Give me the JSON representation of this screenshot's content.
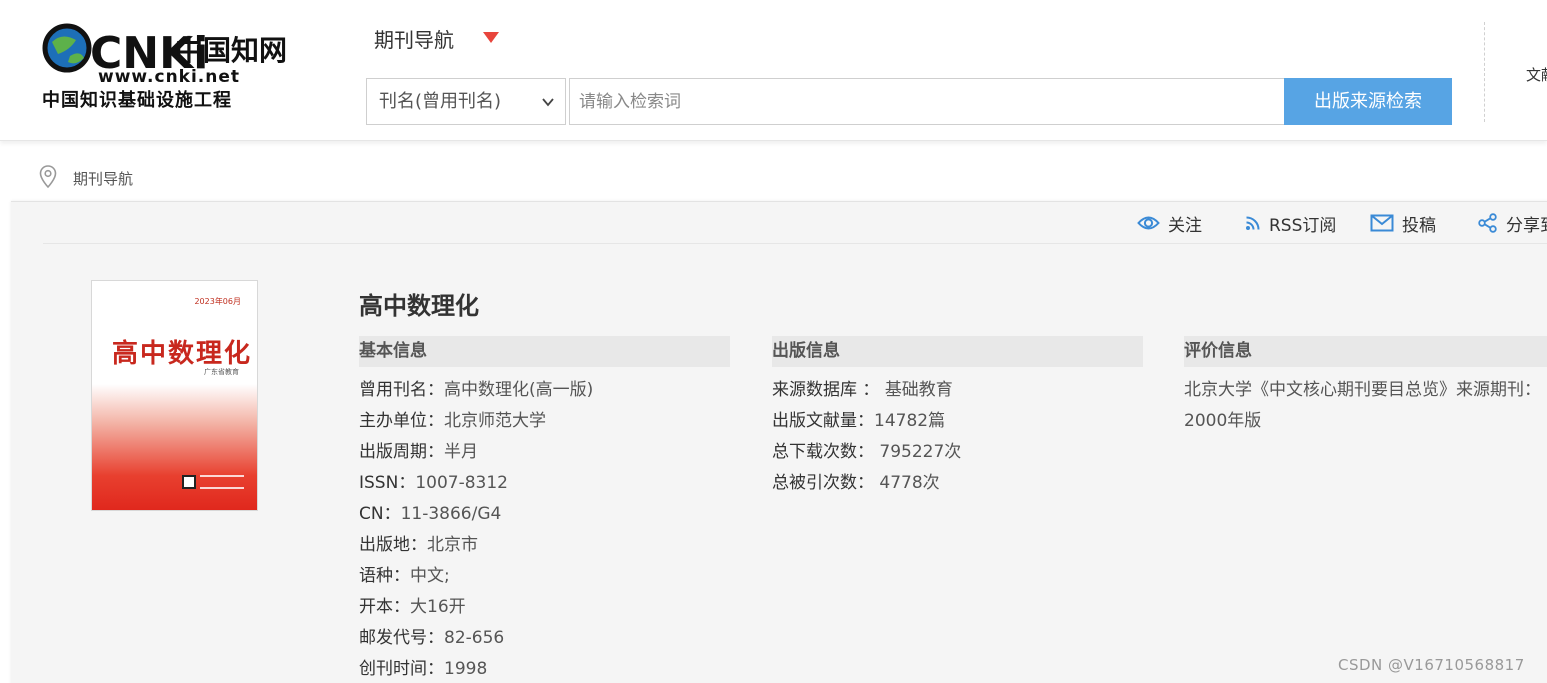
{
  "header": {
    "logo": {
      "brand_latin": "CNKi",
      "brand_cn": "中国知网",
      "url": "www.cnki.net",
      "tagline": "中国知识基础设施工程"
    },
    "nav_title": "期刊导航",
    "search": {
      "field_selected": "刊名(曾用刊名)",
      "placeholder": "请输入检索词",
      "button_label": "出版来源检索"
    },
    "extra_text": "文献"
  },
  "breadcrumb": {
    "label": "期刊导航"
  },
  "toolbar": {
    "follow": "关注",
    "rss": "RSS订阅",
    "submit": "投稿",
    "share": "分享到"
  },
  "journal": {
    "title": "高中数理化",
    "cover": {
      "title": "高中数理化",
      "date": "2023年06月",
      "publisher": "广东省教育"
    },
    "basic_info": {
      "heading": "基本信息",
      "rows": [
        {
          "key": "曾用刊名：",
          "value": "高中数理化(高一版)"
        },
        {
          "key": "主办单位：",
          "value": "北京师范大学"
        },
        {
          "key": "出版周期：",
          "value": "半月"
        },
        {
          "key": "ISSN：",
          "value": "1007-8312"
        },
        {
          "key": "CN：",
          "value": "11-3866/G4"
        },
        {
          "key": "出版地：",
          "value": "北京市"
        },
        {
          "key": "语种：",
          "value": "中文;"
        },
        {
          "key": "开本：",
          "value": "大16开"
        },
        {
          "key": "邮发代号：",
          "value": "82-656"
        },
        {
          "key": "创刊时间：",
          "value": "1998"
        }
      ]
    },
    "publish_info": {
      "heading": "出版信息",
      "rows": [
        {
          "key": "来源数据库 ： ",
          "value": "基础教育"
        },
        {
          "key": "出版文献量：",
          "value": "14782篇"
        },
        {
          "key": "总下载次数： ",
          "value": "795227次"
        },
        {
          "key": "总被引次数： ",
          "value": "4778次"
        }
      ]
    },
    "evaluation_info": {
      "heading": "评价信息",
      "lines": [
        "北京大学《中文核心期刊要目总览》来源期刊：",
        "2000年版"
      ]
    }
  },
  "watermark": "CSDN @V16710568817",
  "colors": {
    "search_button": "#57a4e4",
    "toolbar_icon": "#3a8ad6",
    "nav_arrow": "#e8453c",
    "cover_red": "#e0281d"
  }
}
